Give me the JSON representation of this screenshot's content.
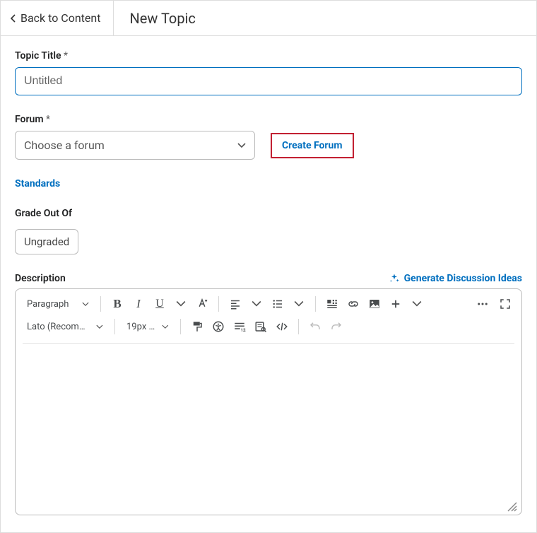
{
  "header": {
    "back_label": "Back to Content",
    "page_title": "New Topic"
  },
  "topic_title": {
    "label": "Topic Title",
    "required_mark": "*",
    "value": "Untitled"
  },
  "forum": {
    "label": "Forum ",
    "required_mark": "*",
    "placeholder": "Choose a forum",
    "create_button": "Create Forum"
  },
  "standards": {
    "label": "Standards"
  },
  "grade": {
    "label": "Grade Out Of",
    "value": "Ungraded"
  },
  "description": {
    "label": "Description",
    "generate_label": "Generate Discussion Ideas"
  },
  "toolbar": {
    "style": "Paragraph",
    "font": "Lato (Recomm…",
    "size": "19px (..."
  }
}
